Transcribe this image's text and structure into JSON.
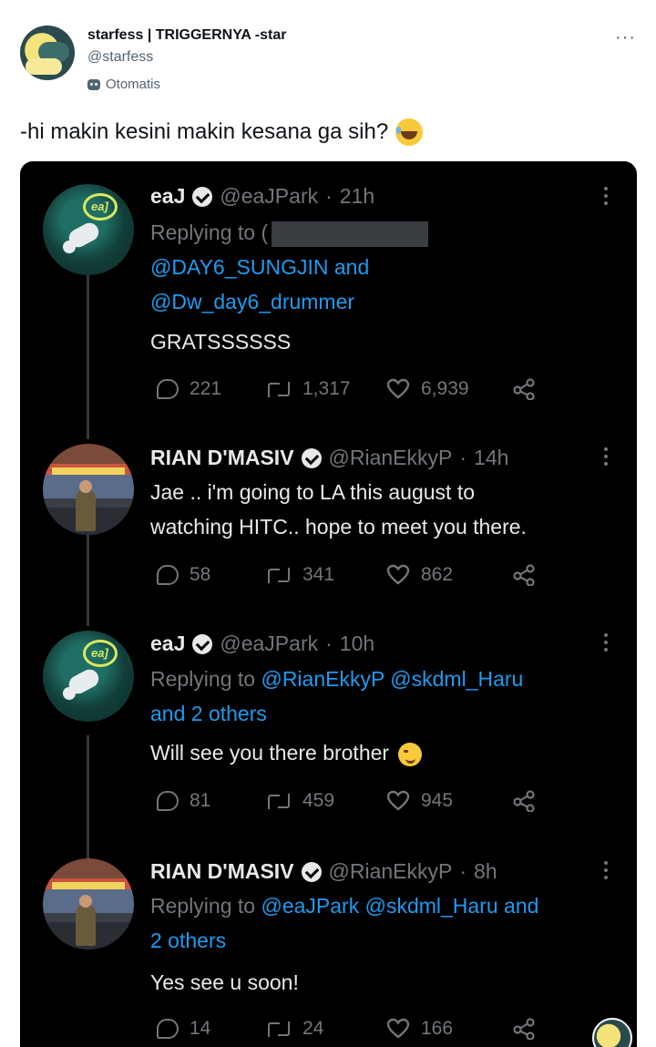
{
  "outer_tweet": {
    "name": "starfess | TRIGGERNYA -star",
    "handle": "@starfess",
    "automated_label": "Otomatis",
    "more_label": "···",
    "text": "-hi makin kesini makin kesana ga sih?",
    "emoji": "face-with-tears-of-joy"
  },
  "replies": [
    {
      "name": "eaJ",
      "handle": "@eaJPark",
      "dot": "·",
      "time": "21h",
      "replying_prefix": "Replying to",
      "replying_line1_tail": "(",
      "replying_line2": "@DAY6_SUNGJIN and",
      "replying_line3": "@Dw_day6_drummer",
      "text": "GRATSSSSSS",
      "replies_count": "221",
      "retweets_count": "1,317",
      "likes_count": "6,939"
    },
    {
      "name": "RIAN D'MASIV",
      "handle": "@RianEkkyP",
      "dot": "·",
      "time": "14h",
      "text_line1": "Jae .. i'm going to LA this august to",
      "text_line2": "watching HITC.. hope to meet you there.",
      "replies_count": "58",
      "retweets_count": "341",
      "likes_count": "862"
    },
    {
      "name": "eaJ",
      "handle": "@eaJPark",
      "dot": "·",
      "time": "10h",
      "replying_prefix": "Replying to",
      "replying_link1": "@RianEkkyP",
      "replying_link2": "@skdml_Haru",
      "replying_line2": "and 2 others",
      "text": "Will see you there brother",
      "emoji": "winking-face",
      "replies_count": "81",
      "retweets_count": "459",
      "likes_count": "945"
    },
    {
      "name": "RIAN D'MASIV",
      "handle": "@RianEkkyP",
      "dot": "·",
      "time": "8h",
      "replying_prefix": "Replying to",
      "replying_link1": "@eaJPark",
      "replying_link2": "@skdml_Haru and",
      "replying_line2": "2 others",
      "text": "Yes see u soon!",
      "replies_count": "14",
      "retweets_count": "24",
      "likes_count": "166"
    }
  ],
  "colors": {
    "card_bg": "#000000",
    "text_primary": "#e7e9ea",
    "text_muted": "#71767b",
    "link": "#1d9bf0"
  }
}
